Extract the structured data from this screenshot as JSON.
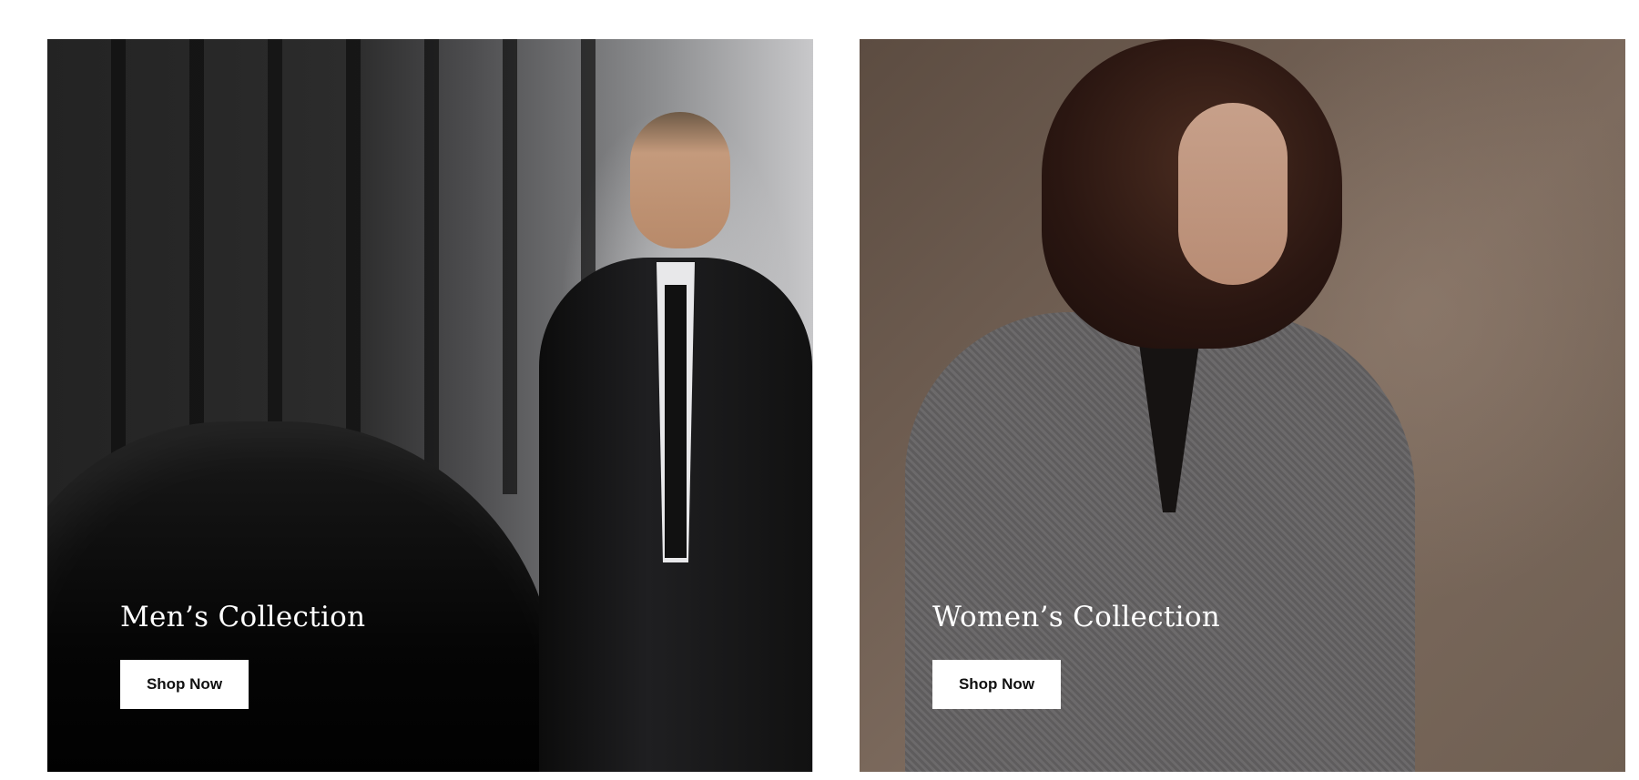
{
  "collections": [
    {
      "title": "Men’s Collection",
      "button_label": "Shop Now"
    },
    {
      "title": "Women’s Collection",
      "button_label": "Shop Now"
    }
  ],
  "colors": {
    "page_background": "#ffffff",
    "button_background": "#ffffff",
    "button_text": "#111111",
    "title_text": "#ffffff"
  }
}
